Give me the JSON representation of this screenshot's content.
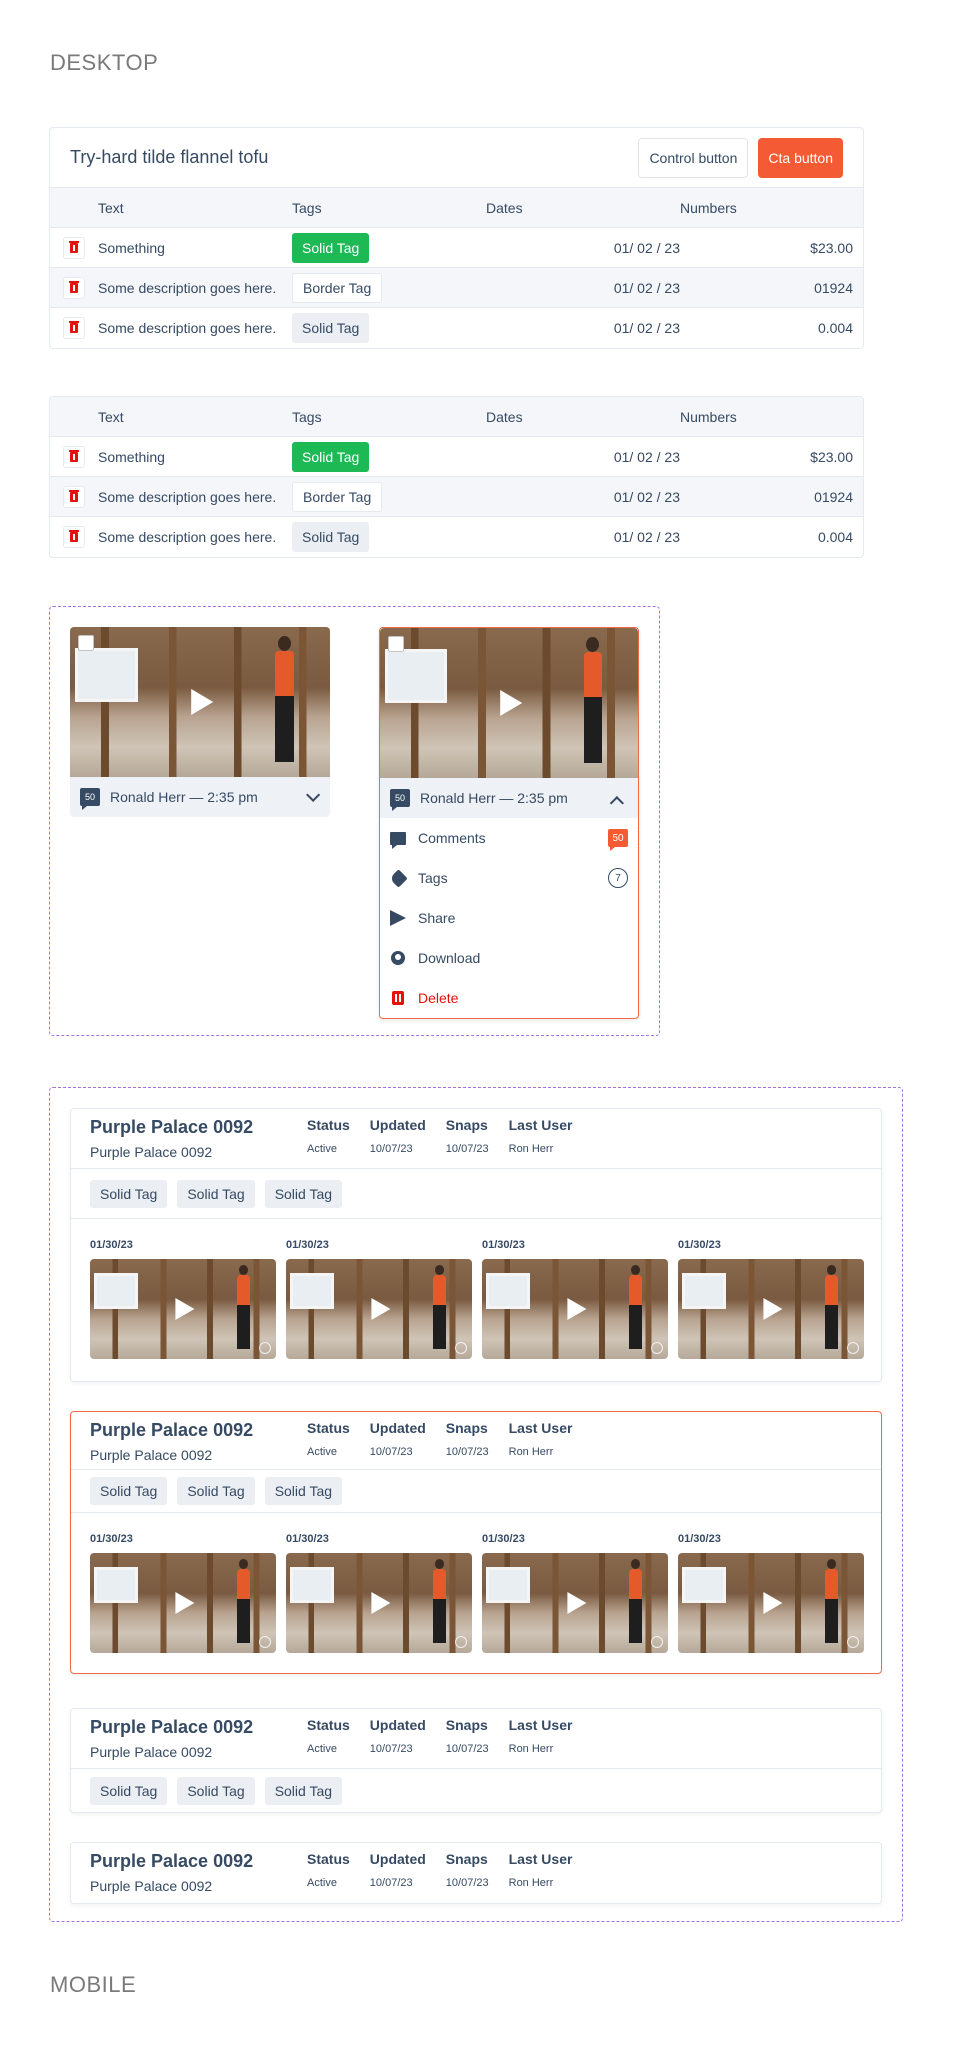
{
  "sections": {
    "desktop": "DESKTOP",
    "mobile": "MOBILE"
  },
  "table1": {
    "title": "Try-hard tilde flannel tofu",
    "control_button": "Control button",
    "cta_button": "Cta button",
    "headers": {
      "text": "Text",
      "tags": "Tags",
      "dates": "Dates",
      "numbers": "Numbers"
    },
    "rows": [
      {
        "text": "Something",
        "tag": "Solid Tag",
        "date": "01/ 02 / 23",
        "number": "$23.00"
      },
      {
        "text": "Some description goes here.",
        "tag": "Border Tag",
        "date": "01/ 02 / 23",
        "number": "01924"
      },
      {
        "text": "Some description goes here.",
        "tag": "Solid Tag",
        "date": "01/ 02 / 23",
        "number": "0.004"
      }
    ]
  },
  "table2": {
    "headers": {
      "text": "Text",
      "tags": "Tags",
      "dates": "Dates",
      "numbers": "Numbers"
    },
    "rows": [
      {
        "text": "Something",
        "tag": "Solid Tag",
        "date": "01/ 02 / 23",
        "number": "$23.00"
      },
      {
        "text": "Some description goes here.",
        "tag": "Border Tag",
        "date": "01/ 02 / 23",
        "number": "01924"
      },
      {
        "text": "Some description goes here.",
        "tag": "Solid Tag",
        "date": "01/ 02 / 23",
        "number": "0.004"
      }
    ]
  },
  "videos": {
    "collapsed": {
      "count": "50",
      "label": "Ronald Herr — 2:35 pm"
    },
    "expanded": {
      "count": "50",
      "label": "Ronald Herr — 2:35 pm",
      "menu": {
        "comments": "Comments",
        "comments_count": "50",
        "tags": "Tags",
        "tags_count": "7",
        "share": "Share",
        "download": "Download",
        "delete": "Delete"
      }
    }
  },
  "properties": {
    "name": "Purple Palace 0092",
    "subname": "Purple Palace 0092",
    "cols": {
      "status_h": "Status",
      "status_v": "Active",
      "updated_h": "Updated",
      "updated_v": "10/07/23",
      "snaps_h": "Snaps",
      "snaps_v": "10/07/23",
      "user_h": "Last User",
      "user_v": "Ron Herr"
    },
    "tag": "Solid Tag",
    "snap_date": "01/30/23"
  },
  "colors": {
    "accent": "#f45b35",
    "green": "#1db954",
    "text": "#364a63",
    "danger": "#e3120b",
    "dashed": "#a970e0"
  }
}
